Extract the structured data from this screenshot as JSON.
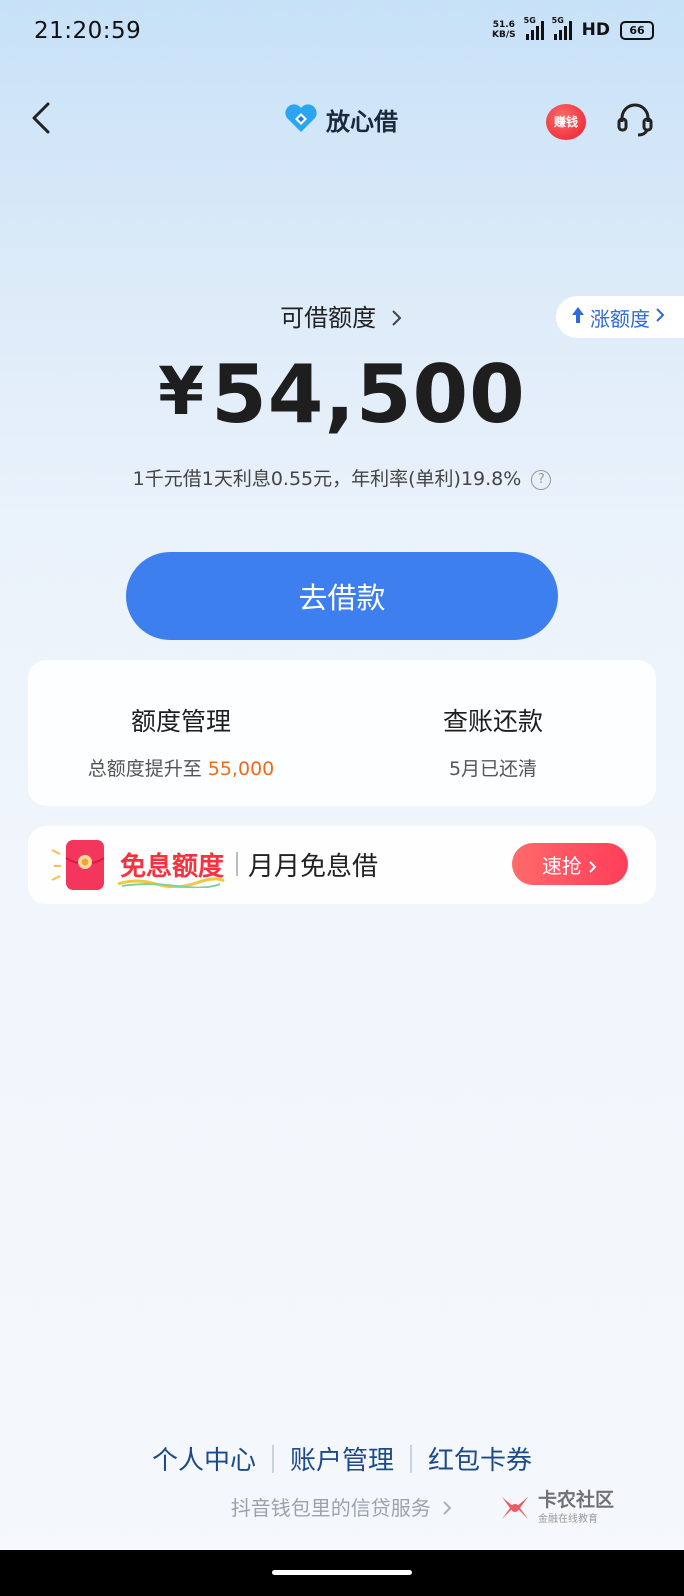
{
  "status_bar": {
    "time": "21:20:59",
    "net_speed_value": "51.6",
    "net_speed_unit": "KB/S",
    "signal1_tag": "5G",
    "signal2_tag": "5G",
    "hd": "HD",
    "battery": "66"
  },
  "header": {
    "brand_name": "放心借",
    "earn_badge": "赚钱"
  },
  "credit": {
    "title": "可借额度",
    "raise_label": "涨额度",
    "currency": "¥",
    "amount": "54,500",
    "rate_text": "1千元借1天利息0.55元，年利率(单利)19.8%",
    "help": "?"
  },
  "actions": {
    "borrow_button": "去借款"
  },
  "card": {
    "left_title": "额度管理",
    "left_sub_prefix": "总额度提升至 ",
    "left_sub_value": "55,000",
    "right_title": "查账还款",
    "right_sub": "5月已还清"
  },
  "promo": {
    "title": "免息额度",
    "subtitle": "月月免息借",
    "button": "速抢"
  },
  "footer": {
    "links": [
      "个人中心",
      "账户管理",
      "红包卡券"
    ],
    "note": "抖音钱包里的信贷服务",
    "watermark_name": "卡农社区",
    "watermark_sub": "金融在线教育"
  },
  "colors": {
    "primary": "#3e7ff0",
    "accent_orange": "#ef6b1c",
    "promo_red": "#f5333f",
    "link_blue": "#1d4a8a"
  },
  "icons": [
    "back-arrow-icon",
    "brand-logo-icon",
    "earn-money-icon",
    "customer-service-icon",
    "raise-arrow-icon",
    "chevron-right-icon",
    "help-icon",
    "red-envelope-icon"
  ]
}
